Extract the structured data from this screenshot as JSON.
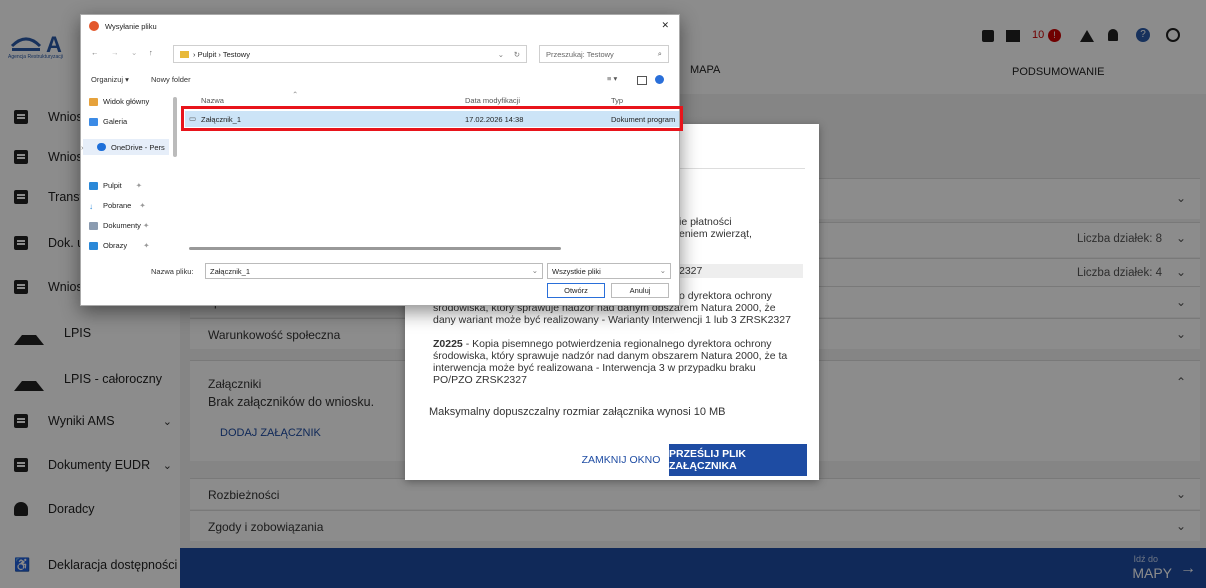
{
  "app": {
    "logo_text": "Agencja Restrukturyzacji",
    "tabs": {
      "mapa": "MAPA",
      "podsumowanie": "PODSUMOWANIE"
    },
    "top_icons": {
      "error_count": "10"
    },
    "sidebar": [
      {
        "label": "Wnios",
        "icon": "document-icon"
      },
      {
        "label": "Wnios",
        "icon": "document-icon"
      },
      {
        "label": "Transf",
        "icon": "document-icon"
      },
      {
        "label": "Dok. u",
        "icon": "document-icon"
      },
      {
        "label": "Wnios",
        "icon": "document-icon"
      },
      {
        "label": "LPIS",
        "icon": "mountain-icon"
      },
      {
        "label": "LPIS - całoroczny",
        "icon": "mountain-icon"
      },
      {
        "label": "Wyniki AMS",
        "icon": "document-icon",
        "chevron": "⌄"
      },
      {
        "label": "Dokumenty EUDR",
        "icon": "document-icon",
        "chevron": "⌄"
      },
      {
        "label": "Doradcy",
        "icon": "person-icon"
      },
      {
        "label": "Deklaracja dostępności",
        "icon": "accessibility-icon"
      }
    ],
    "panels": {
      "warunkowosc_partial": "społeczne",
      "warunkowosc": "Warunkowość społeczna",
      "zalaczniki_title": "Załączniki",
      "zalaczniki_empty": "Brak załączników do wniosku.",
      "dodaj": "DODAJ ZAŁĄCZNIK",
      "rozbieznosci": "Rozbieżności",
      "zgody": "Zgody i zobowiązania",
      "liczba1": "Liczba działek: 8",
      "liczba2": "Liczba działek: 4"
    },
    "bottom": {
      "idz_do": "Idź do",
      "mapy": "MAPY",
      "arrow": "→"
    }
  },
  "modal": {
    "frag1": "ie płatności",
    "frag2": "eniem zwierząt,",
    "frag3": "2327",
    "frag4a": "o dyrektora ochrony",
    "p1": "środowiska, który sprawuje nadzór nad danym obszarem Natura 2000, że dany wariant może być realizowany - Warianty Interwencji 1 lub 3 ZRSK2327",
    "code2": "Z0225",
    "p2": " - Kopia pisemnego potwierdzenia regionalnego dyrektora ochrony środowiska, który sprawuje nadzór nad danym obszarem Natura 2000, że ta interwencja może być realizowana - Interwencja 3 w przypadku braku PO/PZO ZRSK2327",
    "max_size": "Maksymalny dopuszczalny rozmiar załącznika wynosi 10 MB",
    "close": "ZAMKNIJ OKNO",
    "send": "PRZEŚLIJ PLIK ZAŁĄCZNIKA"
  },
  "file_dialog": {
    "title": "Wysyłanie pliku",
    "close": "✕",
    "breadcrumb": "›  Pulpit  ›  Testowy",
    "search_placeholder": "Przeszukaj: Testowy",
    "organize": "Organizuj ▾",
    "new_folder": "Nowy folder",
    "nav": [
      {
        "label": "Widok główny",
        "icon": "home-icon",
        "color": "#e6a23c"
      },
      {
        "label": "Galeria",
        "icon": "gallery-icon",
        "color": "#3c8be6"
      },
      {
        "label": "OneDrive - Pers",
        "icon": "cloud-icon",
        "color": "#1e6fd9"
      },
      {
        "label": "Pulpit",
        "icon": "desktop-icon",
        "color": "#2a88d8"
      },
      {
        "label": "Pobrane",
        "icon": "download-icon",
        "color": "#2a88d8"
      },
      {
        "label": "Dokumenty",
        "icon": "documents-icon",
        "color": "#8a9bb0"
      },
      {
        "label": "Obrazy",
        "icon": "pictures-icon",
        "color": "#2a88d8"
      }
    ],
    "columns": {
      "name": "Nazwa",
      "date": "Data modyfikacji",
      "type": "Typ"
    },
    "files": [
      {
        "name": "Załącznik_1",
        "date": "17.02.2026 14:38",
        "type": "Dokument program"
      }
    ],
    "filename_label": "Nazwa pliku:",
    "filename_value": "Załącznik_1",
    "filter": "Wszystkie pliki",
    "open": "Otwórz",
    "cancel": "Anuluj"
  }
}
